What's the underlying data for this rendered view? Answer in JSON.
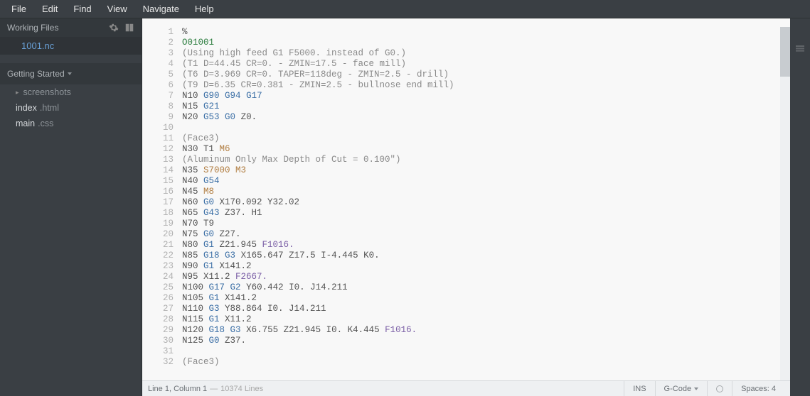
{
  "menu": [
    "File",
    "Edit",
    "Find",
    "View",
    "Navigate",
    "Help"
  ],
  "sidebar": {
    "working_files_title": "Working Files",
    "working_files": [
      "1001.nc"
    ],
    "project_title": "Getting Started",
    "tree": [
      {
        "type": "folder",
        "name": "screenshots"
      },
      {
        "type": "file",
        "name": "index",
        "ext": ".html"
      },
      {
        "type": "file",
        "name": "main",
        "ext": ".css"
      }
    ]
  },
  "editor": {
    "lines": [
      [
        {
          "t": "plain",
          "v": "%"
        }
      ],
      [
        {
          "t": "o",
          "v": "O01001"
        }
      ],
      [
        {
          "t": "comment",
          "v": "(Using high feed G1 F5000. instead of G0.)"
        }
      ],
      [
        {
          "t": "comment",
          "v": "(T1 D=44.45 CR=0. - ZMIN=17.5 - face mill)"
        }
      ],
      [
        {
          "t": "comment",
          "v": "(T6 D=3.969 CR=0. TAPER=118deg - ZMIN=2.5 - drill)"
        }
      ],
      [
        {
          "t": "comment",
          "v": "(T9 D=6.35 CR=0.381 - ZMIN=2.5 - bullnose end mill)"
        }
      ],
      [
        {
          "t": "plain",
          "v": "N10 "
        },
        {
          "t": "g",
          "v": "G90"
        },
        {
          "t": "plain",
          "v": " "
        },
        {
          "t": "g",
          "v": "G94"
        },
        {
          "t": "plain",
          "v": " "
        },
        {
          "t": "g",
          "v": "G17"
        }
      ],
      [
        {
          "t": "plain",
          "v": "N15 "
        },
        {
          "t": "g",
          "v": "G21"
        }
      ],
      [
        {
          "t": "plain",
          "v": "N20 "
        },
        {
          "t": "g",
          "v": "G53"
        },
        {
          "t": "plain",
          "v": " "
        },
        {
          "t": "g",
          "v": "G0"
        },
        {
          "t": "plain",
          "v": " Z0."
        }
      ],
      [],
      [
        {
          "t": "comment",
          "v": "(Face3)"
        }
      ],
      [
        {
          "t": "plain",
          "v": "N30 T1 "
        },
        {
          "t": "m",
          "v": "M6"
        }
      ],
      [
        {
          "t": "comment",
          "v": "(Aluminum Only Max Depth of Cut = 0.100\")"
        }
      ],
      [
        {
          "t": "plain",
          "v": "N35 "
        },
        {
          "t": "s",
          "v": "S7000"
        },
        {
          "t": "plain",
          "v": " "
        },
        {
          "t": "m",
          "v": "M3"
        }
      ],
      [
        {
          "t": "plain",
          "v": "N40 "
        },
        {
          "t": "g",
          "v": "G54"
        }
      ],
      [
        {
          "t": "plain",
          "v": "N45 "
        },
        {
          "t": "m",
          "v": "M8"
        }
      ],
      [
        {
          "t": "plain",
          "v": "N60 "
        },
        {
          "t": "g",
          "v": "G0"
        },
        {
          "t": "plain",
          "v": " X170.092 Y32.02"
        }
      ],
      [
        {
          "t": "plain",
          "v": "N65 "
        },
        {
          "t": "g",
          "v": "G43"
        },
        {
          "t": "plain",
          "v": " Z37. H1"
        }
      ],
      [
        {
          "t": "plain",
          "v": "N70 T9"
        }
      ],
      [
        {
          "t": "plain",
          "v": "N75 "
        },
        {
          "t": "g",
          "v": "G0"
        },
        {
          "t": "plain",
          "v": " Z27."
        }
      ],
      [
        {
          "t": "plain",
          "v": "N80 "
        },
        {
          "t": "g",
          "v": "G1"
        },
        {
          "t": "plain",
          "v": " Z21.945 "
        },
        {
          "t": "f",
          "v": "F1016."
        }
      ],
      [
        {
          "t": "plain",
          "v": "N85 "
        },
        {
          "t": "g",
          "v": "G18"
        },
        {
          "t": "plain",
          "v": " "
        },
        {
          "t": "g",
          "v": "G3"
        },
        {
          "t": "plain",
          "v": " X165.647 Z17.5 I-4.445 K0."
        }
      ],
      [
        {
          "t": "plain",
          "v": "N90 "
        },
        {
          "t": "g",
          "v": "G1"
        },
        {
          "t": "plain",
          "v": " X141.2"
        }
      ],
      [
        {
          "t": "plain",
          "v": "N95 X11.2 "
        },
        {
          "t": "f",
          "v": "F2667."
        }
      ],
      [
        {
          "t": "plain",
          "v": "N100 "
        },
        {
          "t": "g",
          "v": "G17"
        },
        {
          "t": "plain",
          "v": " "
        },
        {
          "t": "g",
          "v": "G2"
        },
        {
          "t": "plain",
          "v": " Y60.442 I0. J14.211"
        }
      ],
      [
        {
          "t": "plain",
          "v": "N105 "
        },
        {
          "t": "g",
          "v": "G1"
        },
        {
          "t": "plain",
          "v": " X141.2"
        }
      ],
      [
        {
          "t": "plain",
          "v": "N110 "
        },
        {
          "t": "g",
          "v": "G3"
        },
        {
          "t": "plain",
          "v": " Y88.864 I0. J14.211"
        }
      ],
      [
        {
          "t": "plain",
          "v": "N115 "
        },
        {
          "t": "g",
          "v": "G1"
        },
        {
          "t": "plain",
          "v": " X11.2"
        }
      ],
      [
        {
          "t": "plain",
          "v": "N120 "
        },
        {
          "t": "g",
          "v": "G18"
        },
        {
          "t": "plain",
          "v": " "
        },
        {
          "t": "g",
          "v": "G3"
        },
        {
          "t": "plain",
          "v": " X6.755 Z21.945 I0. K4.445 "
        },
        {
          "t": "f",
          "v": "F1016."
        }
      ],
      [
        {
          "t": "plain",
          "v": "N125 "
        },
        {
          "t": "g",
          "v": "G0"
        },
        {
          "t": "plain",
          "v": " Z37."
        }
      ],
      [],
      [
        {
          "t": "comment",
          "v": "(Face3)"
        }
      ]
    ]
  },
  "status": {
    "cursor": "Line 1, Column 1",
    "sep": " — ",
    "total": "10374 Lines",
    "ins": "INS",
    "lang": "G-Code",
    "spaces": "Spaces: 4"
  }
}
